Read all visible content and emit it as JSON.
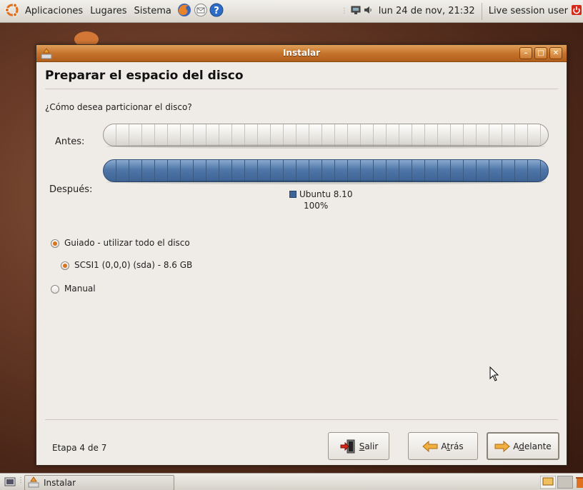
{
  "top_panel": {
    "applications": "Aplicaciones",
    "places": "Lugares",
    "system": "Sistema",
    "clock": "lun 24 de nov, 21:32",
    "user": "Live session user"
  },
  "window": {
    "title": "Instalar"
  },
  "page": {
    "title": "Preparar el espacio del disco",
    "question": "¿Cómo desea particionar el disco?"
  },
  "partition": {
    "before_label": "Antes:",
    "after_label": "Después:",
    "partition_name": "Ubuntu 8.10",
    "partition_percent": "100%",
    "partition_fraction": 1.0,
    "partition_color": "#3d6494"
  },
  "options": {
    "guided": "Guiado - utilizar todo el disco",
    "disk": "SCSI1 (0,0,0) (sda) - 8.6 GB",
    "manual": "Manual"
  },
  "footer": {
    "step": "Etapa 4 de 7",
    "quit_first": "S",
    "quit_rest": "alir",
    "back_pre": "A",
    "back_ul": "t",
    "back_post": "rás",
    "forward_pre": "A",
    "forward_ul": "d",
    "forward_post": "elante"
  },
  "taskbar": {
    "task_label": "Instalar"
  },
  "colors": {
    "accent": "#d8741c",
    "titlebar": "#c6742c"
  }
}
